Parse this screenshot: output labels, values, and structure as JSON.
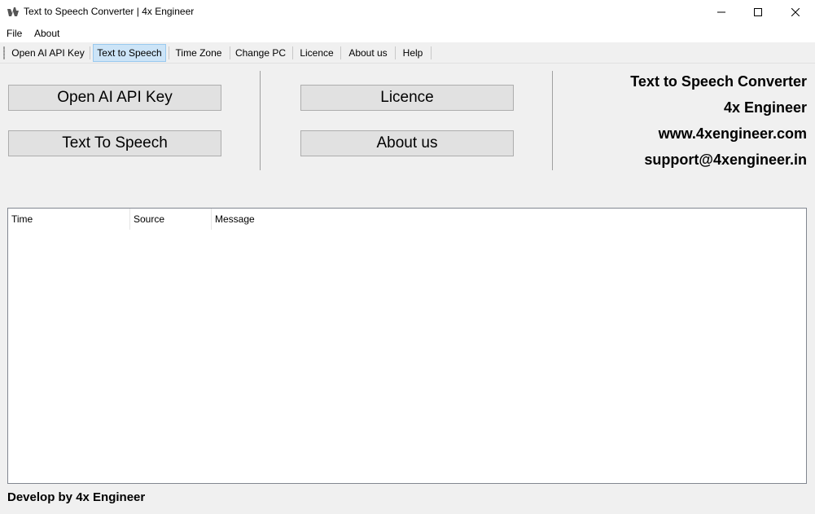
{
  "window": {
    "title": "Text to Speech Converter | 4x Engineer"
  },
  "menubar": {
    "items": [
      {
        "label": "File"
      },
      {
        "label": "About"
      }
    ]
  },
  "toolbar": {
    "items": [
      {
        "label": "Open AI API Key"
      },
      {
        "label": "Text to Speech",
        "active": true
      },
      {
        "label": "Time Zone"
      },
      {
        "label": "Change PC"
      },
      {
        "label": "Licence"
      },
      {
        "label": "About us"
      },
      {
        "label": "Help"
      }
    ]
  },
  "main": {
    "buttons": {
      "open_ai_key": "Open AI API Key",
      "text_to_speech": "Text To Speech",
      "licence": "Licence",
      "about_us": "About us"
    },
    "info": {
      "app_name": "Text to Speech Converter",
      "company": "4x Engineer",
      "website": "www.4xengineer.com",
      "email": "support@4xengineer.in"
    }
  },
  "log": {
    "columns": [
      "Time",
      "Source",
      "Message"
    ],
    "rows": []
  },
  "footer": {
    "text": "Develop by 4x Engineer"
  },
  "icons": {
    "app": "app-icon",
    "minimize": "minimize-icon",
    "maximize": "maximize-icon",
    "close": "close-icon"
  },
  "colors": {
    "window_bg": "#f0f0f0",
    "active_tab_bg": "#cce4f7",
    "active_tab_border": "#99c9ef",
    "button_bg": "#e1e1e1"
  }
}
